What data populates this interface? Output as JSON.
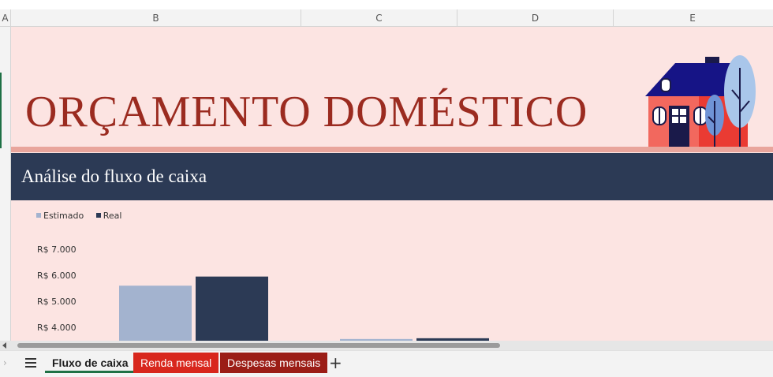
{
  "columns": [
    "A",
    "B",
    "C",
    "D",
    "E"
  ],
  "title": "ORÇAMENTO DOMÉSTICO",
  "banner": "Análise do fluxo de caixa",
  "colors": {
    "title": "#9b2b20",
    "banner_bg": "#2c3a55",
    "sheet_bg": "#fce4e2",
    "estimado": "#a3b3cf",
    "real": "#2c3a55",
    "tab_renda": "#d8271d",
    "tab_despesas": "#9b1d16",
    "active_tab_underline": "#1e7145"
  },
  "chart_data": {
    "type": "bar",
    "legend": [
      "Estimado",
      "Real"
    ],
    "legend_position": "top-left",
    "y_ticks": [
      "R$ 7.000",
      "R$ 6.000",
      "R$ 5.000",
      "R$ 4.000"
    ],
    "y_tick_values": [
      7000,
      6000,
      5000,
      4000
    ],
    "ylim_visible": [
      3450,
      7000
    ],
    "series": [
      {
        "name": "Estimado",
        "values": [
          5600,
          3550
        ]
      },
      {
        "name": "Real",
        "values": [
          5950,
          3580
        ]
      }
    ]
  },
  "tabs": {
    "menu_icon": "hamburger-menu-icon",
    "items": [
      {
        "label": "Fluxo de caixa",
        "active": true
      },
      {
        "label": "Renda mensal",
        "active": false
      },
      {
        "label": "Despesas mensais",
        "active": false
      }
    ],
    "add_label": "+"
  }
}
